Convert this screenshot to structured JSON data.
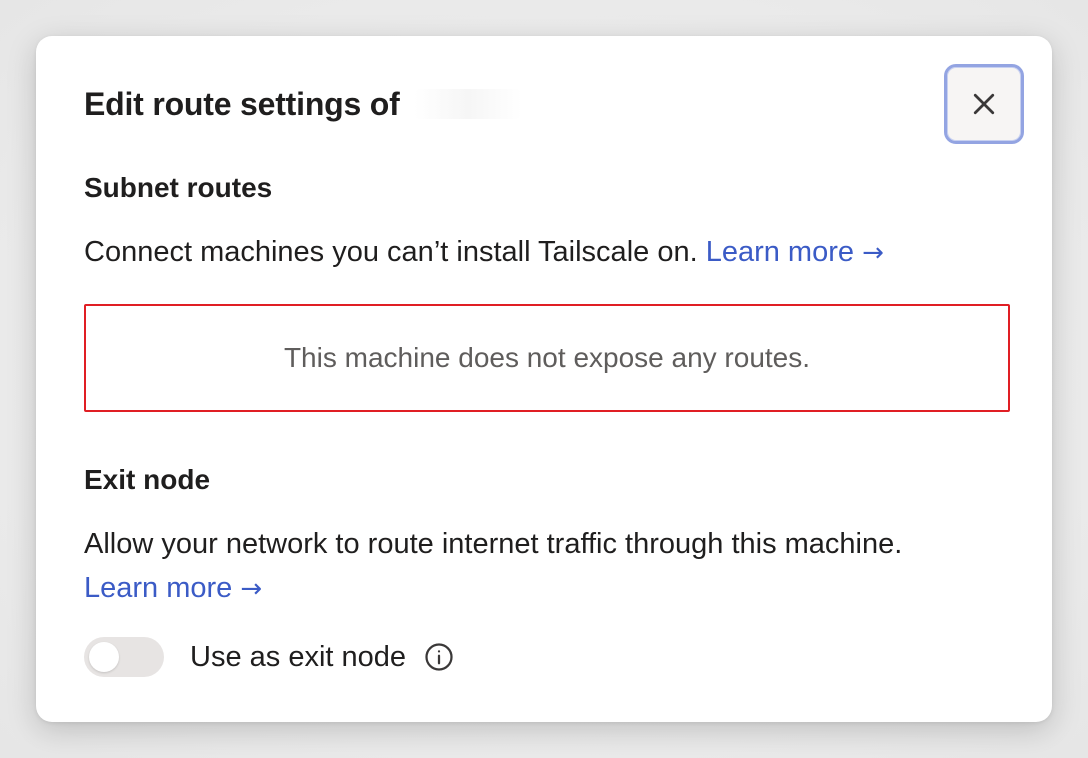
{
  "dialog": {
    "title": "Edit route settings of",
    "close_icon": "close-icon"
  },
  "subnet": {
    "title": "Subnet routes",
    "description": "Connect machines you can’t install Tailscale on.",
    "learn_more": "Learn more",
    "learn_more_arrow": "→",
    "empty_message": "This machine does not expose any routes."
  },
  "exit_node": {
    "title": "Exit node",
    "description": "Allow your network to route internet traffic through this machine.",
    "learn_more": "Learn more",
    "learn_more_arrow": "→",
    "toggle_label": "Use as exit node",
    "toggle_on": false,
    "info_icon": "info-icon"
  },
  "colors": {
    "link": "#3b5bc6",
    "highlight_border": "#e01e24",
    "focus_ring": "#93a4e2"
  }
}
